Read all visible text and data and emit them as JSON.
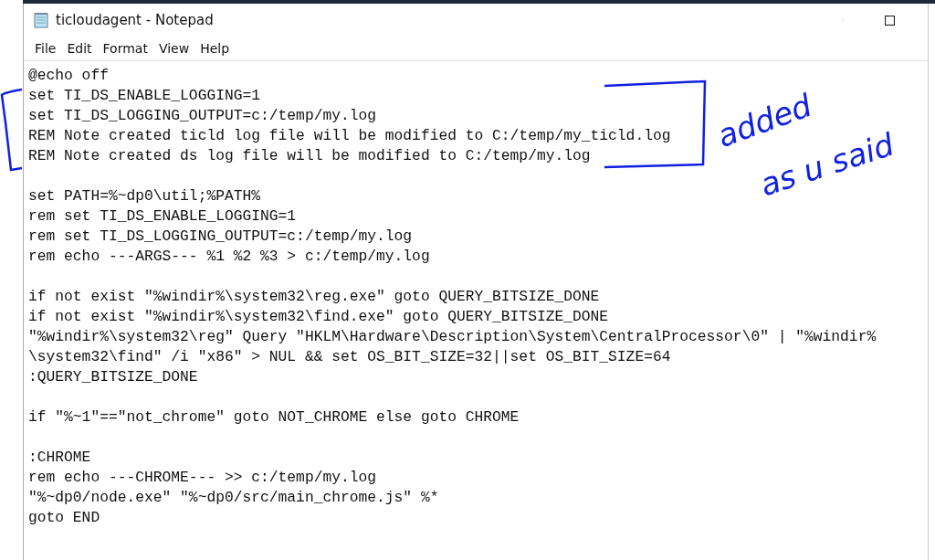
{
  "window": {
    "title": "ticloudagent - Notepad"
  },
  "menu": [
    "File",
    "Edit",
    "Format",
    "View",
    "Help"
  ],
  "editor": {
    "blocks": [
      [
        "@echo off",
        "set TI_DS_ENABLE_LOGGING=1",
        "set TI_DS_LOGGING_OUTPUT=c:/temp/my.log",
        "REM Note created ticld log file will be modified to C:/temp/my_ticld.log",
        "REM Note created ds log file will be modified to C:/temp/my.log"
      ],
      [
        "set PATH=%~dp0\\util;%PATH%",
        "rem set TI_DS_ENABLE_LOGGING=1",
        "rem set TI_DS_LOGGING_OUTPUT=c:/temp/my.log",
        "rem echo ---ARGS--- %1 %2 %3 > c:/temp/my.log"
      ],
      [
        "if not exist \"%windir%\\system32\\reg.exe\" goto QUERY_BITSIZE_DONE",
        "if not exist \"%windir%\\system32\\find.exe\" goto QUERY_BITSIZE_DONE",
        "\"%windir%\\system32\\reg\" Query \"HKLM\\Hardware\\Description\\System\\CentralProcessor\\0\" | \"%windir%",
        "\\system32\\find\" /i \"x86\" > NUL && set OS_BIT_SIZE=32||set OS_BIT_SIZE=64",
        ":QUERY_BITSIZE_DONE"
      ],
      [
        "if \"%~1\"==\"not_chrome\" goto NOT_CHROME else goto CHROME"
      ],
      [
        ":CHROME",
        "rem echo ---CHROME--- >> c:/temp/my.log",
        "\"%~dp0/node.exe\" \"%~dp0/src/main_chrome.js\" %*",
        "goto END"
      ]
    ]
  },
  "annotation": {
    "lines": [
      "added",
      "as u said"
    ]
  }
}
